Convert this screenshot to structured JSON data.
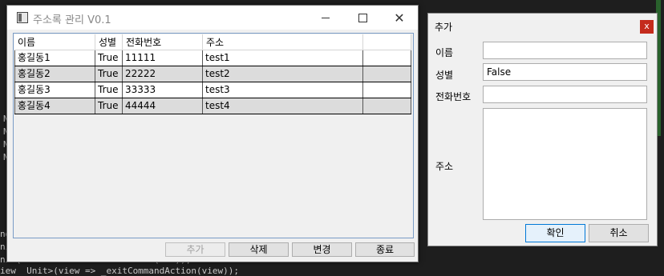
{
  "background": {
    "lines": [
      "N",
      "N",
      "N",
      "N",
      "nd",
      "ni",
      "ni (... ...RouteCommandAction(...));",
      "iew  Unit>(view => _exitCommandAction(view));"
    ]
  },
  "main_window": {
    "title": "주소록 관리 V0.1",
    "columns": [
      "이름",
      "성별",
      "전화번호",
      "주소",
      ""
    ],
    "rows": [
      {
        "name": "홍길동1",
        "gender": "True",
        "phone": "11111",
        "address": "test1"
      },
      {
        "name": "홍길동2",
        "gender": "True",
        "phone": "22222",
        "address": "test2"
      },
      {
        "name": "홍길동3",
        "gender": "True",
        "phone": "33333",
        "address": "test3"
      },
      {
        "name": "홍길동4",
        "gender": "True",
        "phone": "44444",
        "address": "test4"
      }
    ],
    "buttons": {
      "add": "추가",
      "delete": "삭제",
      "edit": "변경",
      "exit": "종료"
    }
  },
  "add_dialog": {
    "title": "추가",
    "close_label": "x",
    "labels": {
      "name": "이름",
      "gender": "성별",
      "phone": "전화번호",
      "address": "주소"
    },
    "values": {
      "name": "",
      "gender": "False",
      "phone": "",
      "address": ""
    },
    "buttons": {
      "ok": "확인",
      "cancel": "취소"
    }
  },
  "colors": {
    "close_red": "#c42b1c",
    "grid_border": "#7a9cc6",
    "alt_row": "#dcdcdc",
    "ok_focus": "#0078d7"
  }
}
